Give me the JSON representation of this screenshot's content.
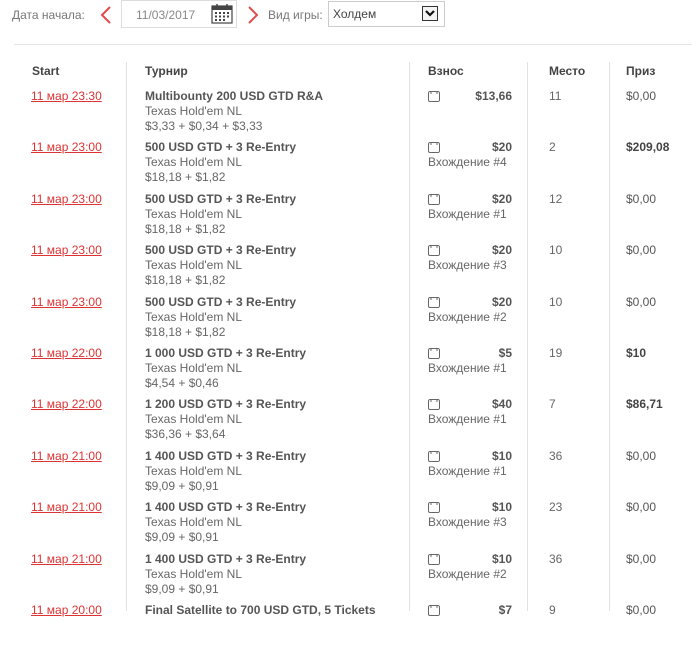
{
  "filters": {
    "start_date_label": "Дата начала:",
    "date_value": "11/03/2017",
    "game_type_label": "Вид игры:",
    "game_type_selected": "Холдем"
  },
  "table": {
    "headers": {
      "start": "Start",
      "tournament": "Турнир",
      "buyin": "Взнос",
      "place": "Место",
      "prize": "Приз"
    },
    "rows": [
      {
        "start": "11 мар 23:30",
        "name": "Multibounty 200 USD GTD R&A",
        "game": "Texas Hold'em NL",
        "fee": "$3,33 + $0,34 + $3,33",
        "amount": "$13,66",
        "entry": "",
        "place": "11",
        "prize": "$0,00",
        "win": false
      },
      {
        "start": "11 мар 23:00",
        "name": "500 USD GTD + 3 Re-Entry",
        "game": "Texas Hold'em NL",
        "fee": "$18,18 + $1,82",
        "amount": "$20",
        "entry": "Вхождение #4",
        "place": "2",
        "prize": "$209,08",
        "win": true
      },
      {
        "start": "11 мар 23:00",
        "name": "500 USD GTD + 3 Re-Entry",
        "game": "Texas Hold'em NL",
        "fee": "$18,18 + $1,82",
        "amount": "$20",
        "entry": "Вхождение #1",
        "place": "12",
        "prize": "$0,00",
        "win": false
      },
      {
        "start": "11 мар 23:00",
        "name": "500 USD GTD + 3 Re-Entry",
        "game": "Texas Hold'em NL",
        "fee": "$18,18 + $1,82",
        "amount": "$20",
        "entry": "Вхождение #3",
        "place": "10",
        "prize": "$0,00",
        "win": false
      },
      {
        "start": "11 мар 23:00",
        "name": "500 USD GTD + 3 Re-Entry",
        "game": "Texas Hold'em NL",
        "fee": "$18,18 + $1,82",
        "amount": "$20",
        "entry": "Вхождение #2",
        "place": "10",
        "prize": "$0,00",
        "win": false
      },
      {
        "start": "11 мар 22:00",
        "name": "1 000 USD GTD + 3 Re-Entry",
        "game": "Texas Hold'em NL",
        "fee": "$4,54 + $0,46",
        "amount": "$5",
        "entry": "Вхождение #1",
        "place": "19",
        "prize": "$10",
        "win": true
      },
      {
        "start": "11 мар 22:00",
        "name": "1 200 USD GTD + 3 Re-Entry",
        "game": "Texas Hold'em NL",
        "fee": "$36,36 + $3,64",
        "amount": "$40",
        "entry": "Вхождение #1",
        "place": "7",
        "prize": "$86,71",
        "win": true
      },
      {
        "start": "11 мар 21:00",
        "name": "1 400 USD GTD + 3 Re-Entry",
        "game": "Texas Hold'em NL",
        "fee": "$9,09 + $0,91",
        "amount": "$10",
        "entry": "Вхождение #1",
        "place": "36",
        "prize": "$0,00",
        "win": false
      },
      {
        "start": "11 мар 21:00",
        "name": "1 400 USD GTD + 3 Re-Entry",
        "game": "Texas Hold'em NL",
        "fee": "$9,09 + $0,91",
        "amount": "$10",
        "entry": "Вхождение #3",
        "place": "23",
        "prize": "$0,00",
        "win": false
      },
      {
        "start": "11 мар 21:00",
        "name": "1 400 USD GTD + 3 Re-Entry",
        "game": "Texas Hold'em NL",
        "fee": "$9,09 + $0,91",
        "amount": "$10",
        "entry": "Вхождение #2",
        "place": "36",
        "prize": "$0,00",
        "win": false
      },
      {
        "start": "11 мар 20:00",
        "name": "Final Satellite to 700 USD GTD, 5 Tickets",
        "game": "",
        "fee": "",
        "amount": "$7",
        "entry": "",
        "place": "9",
        "prize": "$0,00",
        "win": false
      }
    ]
  },
  "colors": {
    "link_red": "#dd3333",
    "chevron_red": "#e24b4b"
  },
  "icons": {
    "prev": "chevron-left-icon",
    "next": "chevron-right-icon",
    "calendar": "calendar-icon",
    "dropdown": "chevron-down-icon",
    "ticket": "ticket-icon"
  }
}
